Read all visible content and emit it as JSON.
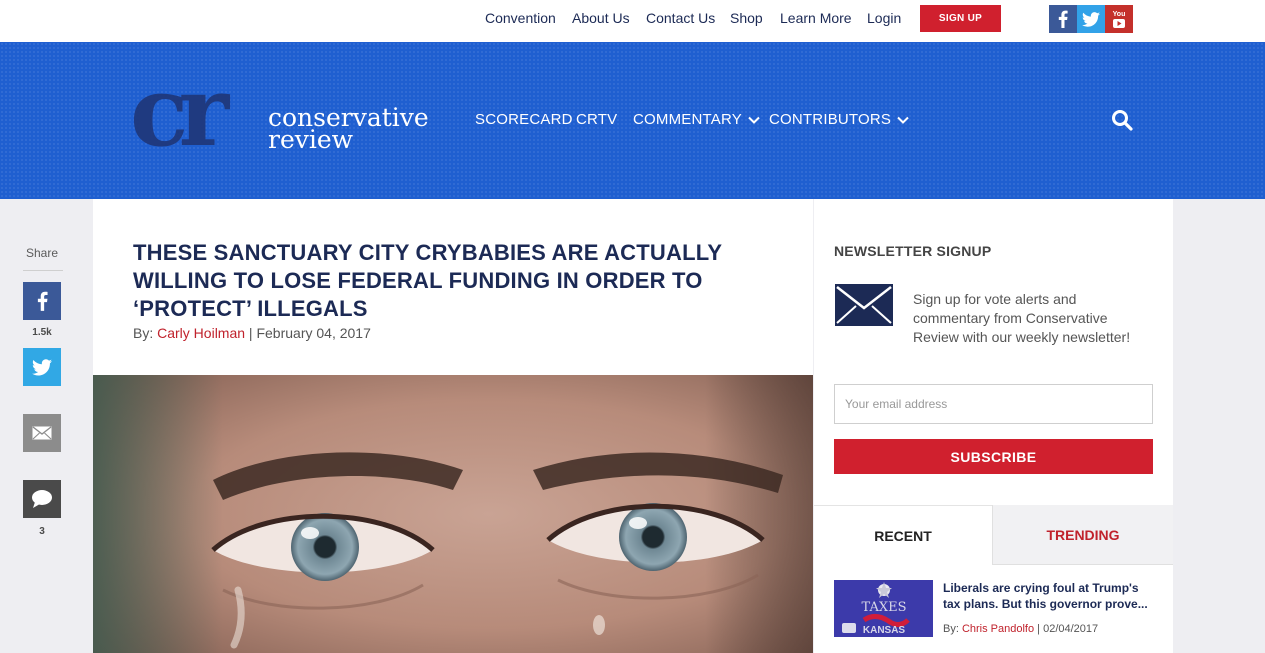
{
  "topbar": {
    "links": [
      "Convention",
      "About Us",
      "Contact Us",
      "Shop",
      "Learn More",
      "Login"
    ],
    "signup_label": "SIGN UP",
    "social": [
      "facebook-icon",
      "twitter-icon",
      "youtube-icon"
    ],
    "youtube_glyph": "You"
  },
  "header": {
    "logo_mark": "cr",
    "logo_line1": "conservative",
    "logo_line2": "review",
    "nav": [
      {
        "label": "SCORECARD",
        "dropdown": false
      },
      {
        "label": "CRTV",
        "dropdown": false
      },
      {
        "label": "COMMENTARY",
        "dropdown": true
      },
      {
        "label": "CONTRIBUTORS",
        "dropdown": true
      }
    ],
    "search_icon": "search-icon"
  },
  "share": {
    "label": "Share",
    "facebook_count": "1.5k",
    "comment_count": "3"
  },
  "article": {
    "headline": "THESE SANCTUARY CITY CRYBABIES ARE ACTUALLY WILLING TO LOSE FEDERAL FUNDING IN ORDER TO ‘PROTECT’ ILLEGALS",
    "by_prefix": "By: ",
    "author": "Carly Hoilman",
    "separator": " | ",
    "date": "February 04, 2017"
  },
  "sidebar": {
    "newsletter_title": "NEWSLETTER SIGNUP",
    "newsletter_text": "Sign up for vote alerts and commentary from Conservative Review with our weekly newsletter!",
    "email_placeholder": "Your email address",
    "subscribe_label": "SUBSCRIBE",
    "tabs": {
      "recent": "RECENT",
      "trending": "TRENDING"
    },
    "stories": [
      {
        "title": "Liberals are crying foul at Trump's tax plans. But this governor prove...",
        "by_prefix": "By: ",
        "author": "Chris Pandolfo",
        "separator": " | ",
        "date": "02/04/2017",
        "thumb_text_top": "TAXES",
        "thumb_text_bottom": "KANSAS"
      }
    ]
  },
  "colors": {
    "brand_blue": "#1f5fd0",
    "navy": "#1c2a55",
    "accent_red": "#d0202e"
  }
}
